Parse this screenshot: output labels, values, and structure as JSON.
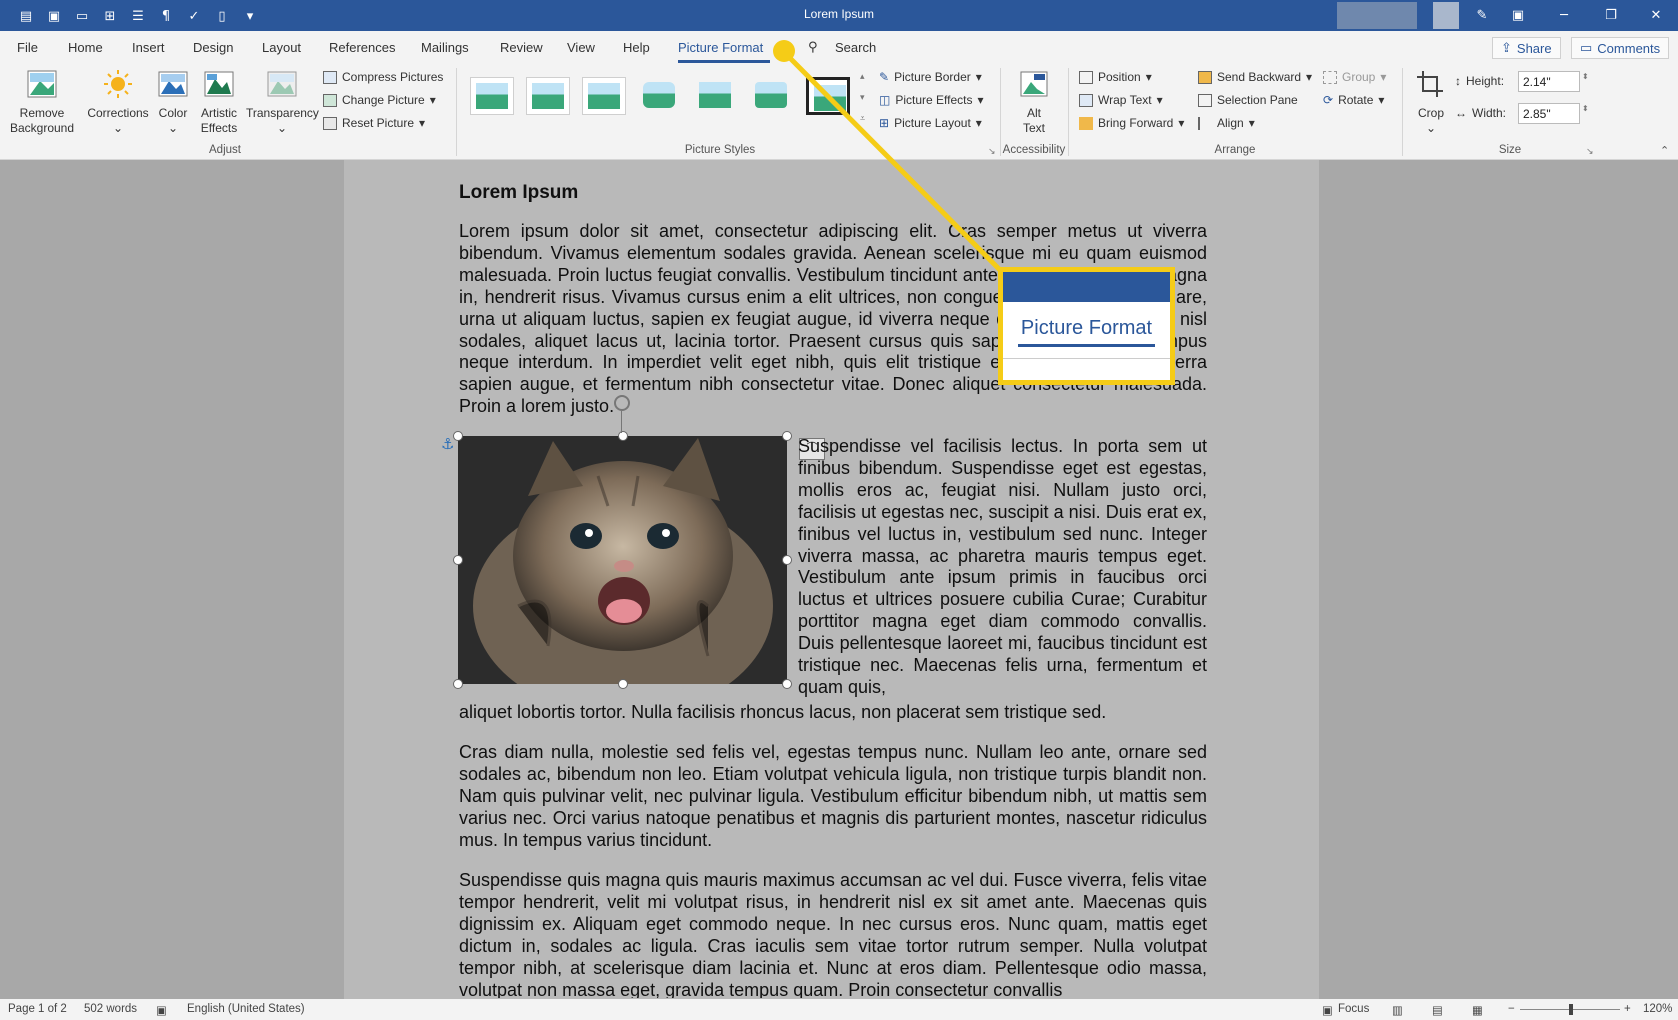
{
  "window": {
    "title": "Lorem Ipsum",
    "qat_icons": [
      "save-icon",
      "save-as-icon",
      "open-folder-icon",
      "layout-icon",
      "print-layout-icon",
      "paragraph-mark-icon",
      "spelling-icon",
      "new-document-icon",
      "customize-qat-icon"
    ]
  },
  "tabs": [
    "File",
    "Home",
    "Insert",
    "Design",
    "Layout",
    "References",
    "Mailings",
    "Review",
    "View",
    "Help",
    "Picture Format"
  ],
  "active_tab": "Picture Format",
  "search_label": "Search",
  "share_label": "Share",
  "comments_label": "Comments",
  "ribbon": {
    "adjust": {
      "remove_background": [
        "Remove",
        "Background"
      ],
      "corrections": "Corrections",
      "color": "Color",
      "artistic_effects": [
        "Artistic",
        "Effects"
      ],
      "transparency": "Transparency",
      "compress": "Compress Pictures",
      "change": "Change Picture",
      "reset": "Reset Picture",
      "group_label": "Adjust"
    },
    "styles": {
      "group_label": "Picture Styles",
      "border": "Picture Border",
      "effects": "Picture Effects",
      "layout": "Picture Layout"
    },
    "accessibility": {
      "alt_text": [
        "Alt",
        "Text"
      ],
      "group_label": "Accessibility"
    },
    "arrange": {
      "position": "Position",
      "wrap_text": "Wrap Text",
      "bring_forward": "Bring Forward",
      "send_backward": "Send Backward",
      "selection_pane": "Selection Pane",
      "align": "Align",
      "group": "Group",
      "rotate": "Rotate",
      "group_label": "Arrange"
    },
    "size": {
      "crop": "Crop",
      "height_label": "Height:",
      "height_value": "2.14\"",
      "width_label": "Width:",
      "width_value": "2.85\"",
      "group_label": "Size"
    }
  },
  "document": {
    "heading": "Lorem Ipsum",
    "p1": "Lorem ipsum dolor sit amet, consectetur adipiscing elit. Cras semper metus ut viverra bibendum. Vivamus elementum sodales gravida. Aenean scelerisque mi eu quam euismod malesuada. Proin luctus feugiat convallis. Vestibulum tincidunt ante nec nunt, egestas magna in, hendrerit risus. Vivamus cursus enim a elit ultrices, non congue leo lacinia. Nulla ornare, urna ut aliquam luctus, sapien ex feugiat augue, id viverra neque dui at neque. Cras ac nisl sodales, aliquet lacus ut, lacinia tortor. Praesent cursus quis sapien commodo, id tempus neque interdum. In imperdiet velit eget nibh, quis elit tristique elit tempor. Donec viverra sapien augue, et fermentum nibh consectetur vitae. Donec aliquet consectetur malesuada. Proin a lorem justo.",
    "p2_wrap": "Suspendisse vel facilisis lectus. In porta sem ut finibus bibendum. Suspendisse eget est egestas, mollis eros ac, feugiat nisi. Nullam justo orci, facilisis ut egestas nec, suscipit a nisi. Duis erat ex, finibus vel luctus in, vestibulum sed nunc. Integer viverra massa, ac pharetra mauris tempus eget. Vestibulum ante ipsum primis in faucibus orci luctus et ultrices posuere cubilia Curae; Curabitur porttitor magna eget diam commodo convallis. Duis pellentesque laoreet mi, faucibus tincidunt est tristique nec. Maecenas felis urna, fermentum et quam quis,",
    "p2_tail": "aliquet lobortis tortor. Nulla facilisis rhoncus lacus, non placerat sem tristique sed.",
    "p3": "Cras diam nulla, molestie sed felis vel, egestas tempus nunc. Nullam leo ante, ornare sed sodales ac, bibendum non leo. Etiam volutpat vehicula ligula, non tristique turpis blandit non. Nam quis pulvinar velit, nec pulvinar ligula. Vestibulum efficitur bibendum nibh, ut mattis sem varius nec. Orci varius natoque penatibus et magnis dis parturient montes, nascetur ridiculus mus. In tempus varius tincidunt.",
    "p4": "Suspendisse quis magna quis mauris maximus accumsan ac vel dui. Fusce viverra, felis vitae tempor hendrerit, velit mi volutpat risus, in hendrerit nisl ex sit amet ante. Maecenas quis dignissim ex. Aliquam eget commodo neque. In nec cursus eros. Nunc quam, mattis eget dictum in, sodales ac ligula. Cras iaculis sem vitae tortor rutrum semper. Nulla volutpat tempor nibh, at scelerisque diam lacinia et. Nunc at eros diam. Pellentesque odio massa, volutpat non massa eget, gravida tempus quam. Proin consectetur convallis"
  },
  "callout": {
    "label": "Picture Format",
    "color": "#f5cc17"
  },
  "status": {
    "page": "Page 1 of 2",
    "words": "502 words",
    "language": "English (United States)",
    "focus": "Focus",
    "zoom": "120%",
    "zoom_minus": "−",
    "zoom_plus": "+"
  },
  "colors": {
    "accent": "#2b579a",
    "highlight": "#f5cc17"
  }
}
